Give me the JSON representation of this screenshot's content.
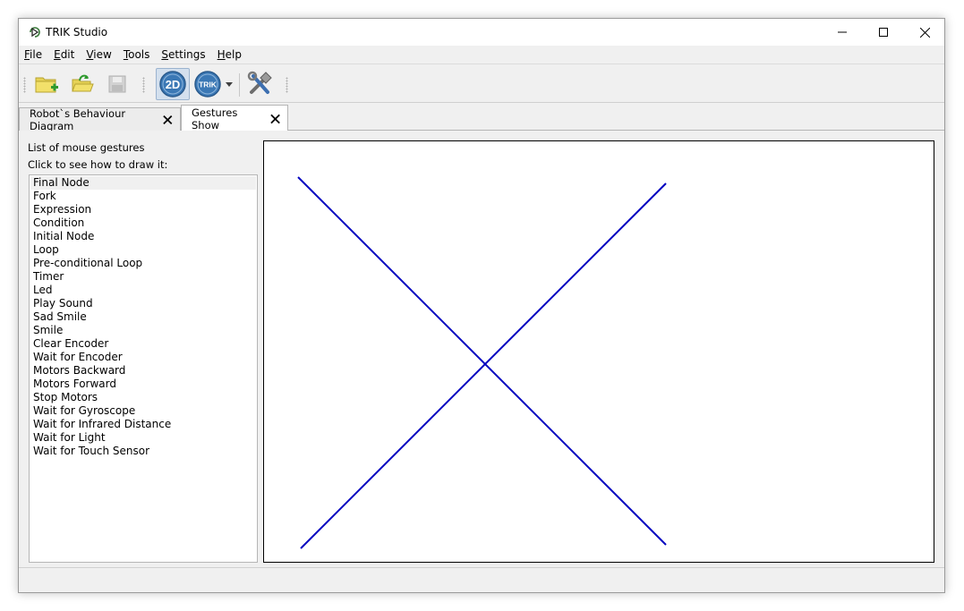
{
  "window": {
    "title": "TRIK Studio"
  },
  "menu": [
    {
      "accel": "F",
      "rest": "ile"
    },
    {
      "accel": "E",
      "rest": "dit"
    },
    {
      "accel": "V",
      "rest": "iew"
    },
    {
      "accel": "T",
      "rest": "ools"
    },
    {
      "accel": "S",
      "rest": "ettings"
    },
    {
      "accel": "H",
      "rest": "elp"
    }
  ],
  "toolbar": {
    "mode_2d_label": "2D",
    "trik_label": "TRIK"
  },
  "tabs": [
    {
      "label": "Robot`s Behaviour Diagram",
      "active": false
    },
    {
      "label": "Gestures Show",
      "active": true
    }
  ],
  "gestures": {
    "list_title": "List of mouse gestures",
    "list_hint": "Click to see how to draw it:",
    "selected_index": 0,
    "items": [
      "Final Node",
      "Fork",
      "Expression",
      "Condition",
      "Initial Node",
      "Loop",
      "Pre-conditional Loop",
      "Timer",
      "Led",
      "Play Sound",
      "Sad Smile",
      "Smile",
      "Clear Encoder",
      "Wait for Encoder",
      "Motors Backward",
      "Motors Forward",
      "Stop Motors",
      "Wait for Gyroscope",
      "Wait for Infrared Distance",
      "Wait for Light",
      "Wait for Touch Sensor"
    ]
  },
  "colors": {
    "gesture_stroke": "#0000c0"
  }
}
